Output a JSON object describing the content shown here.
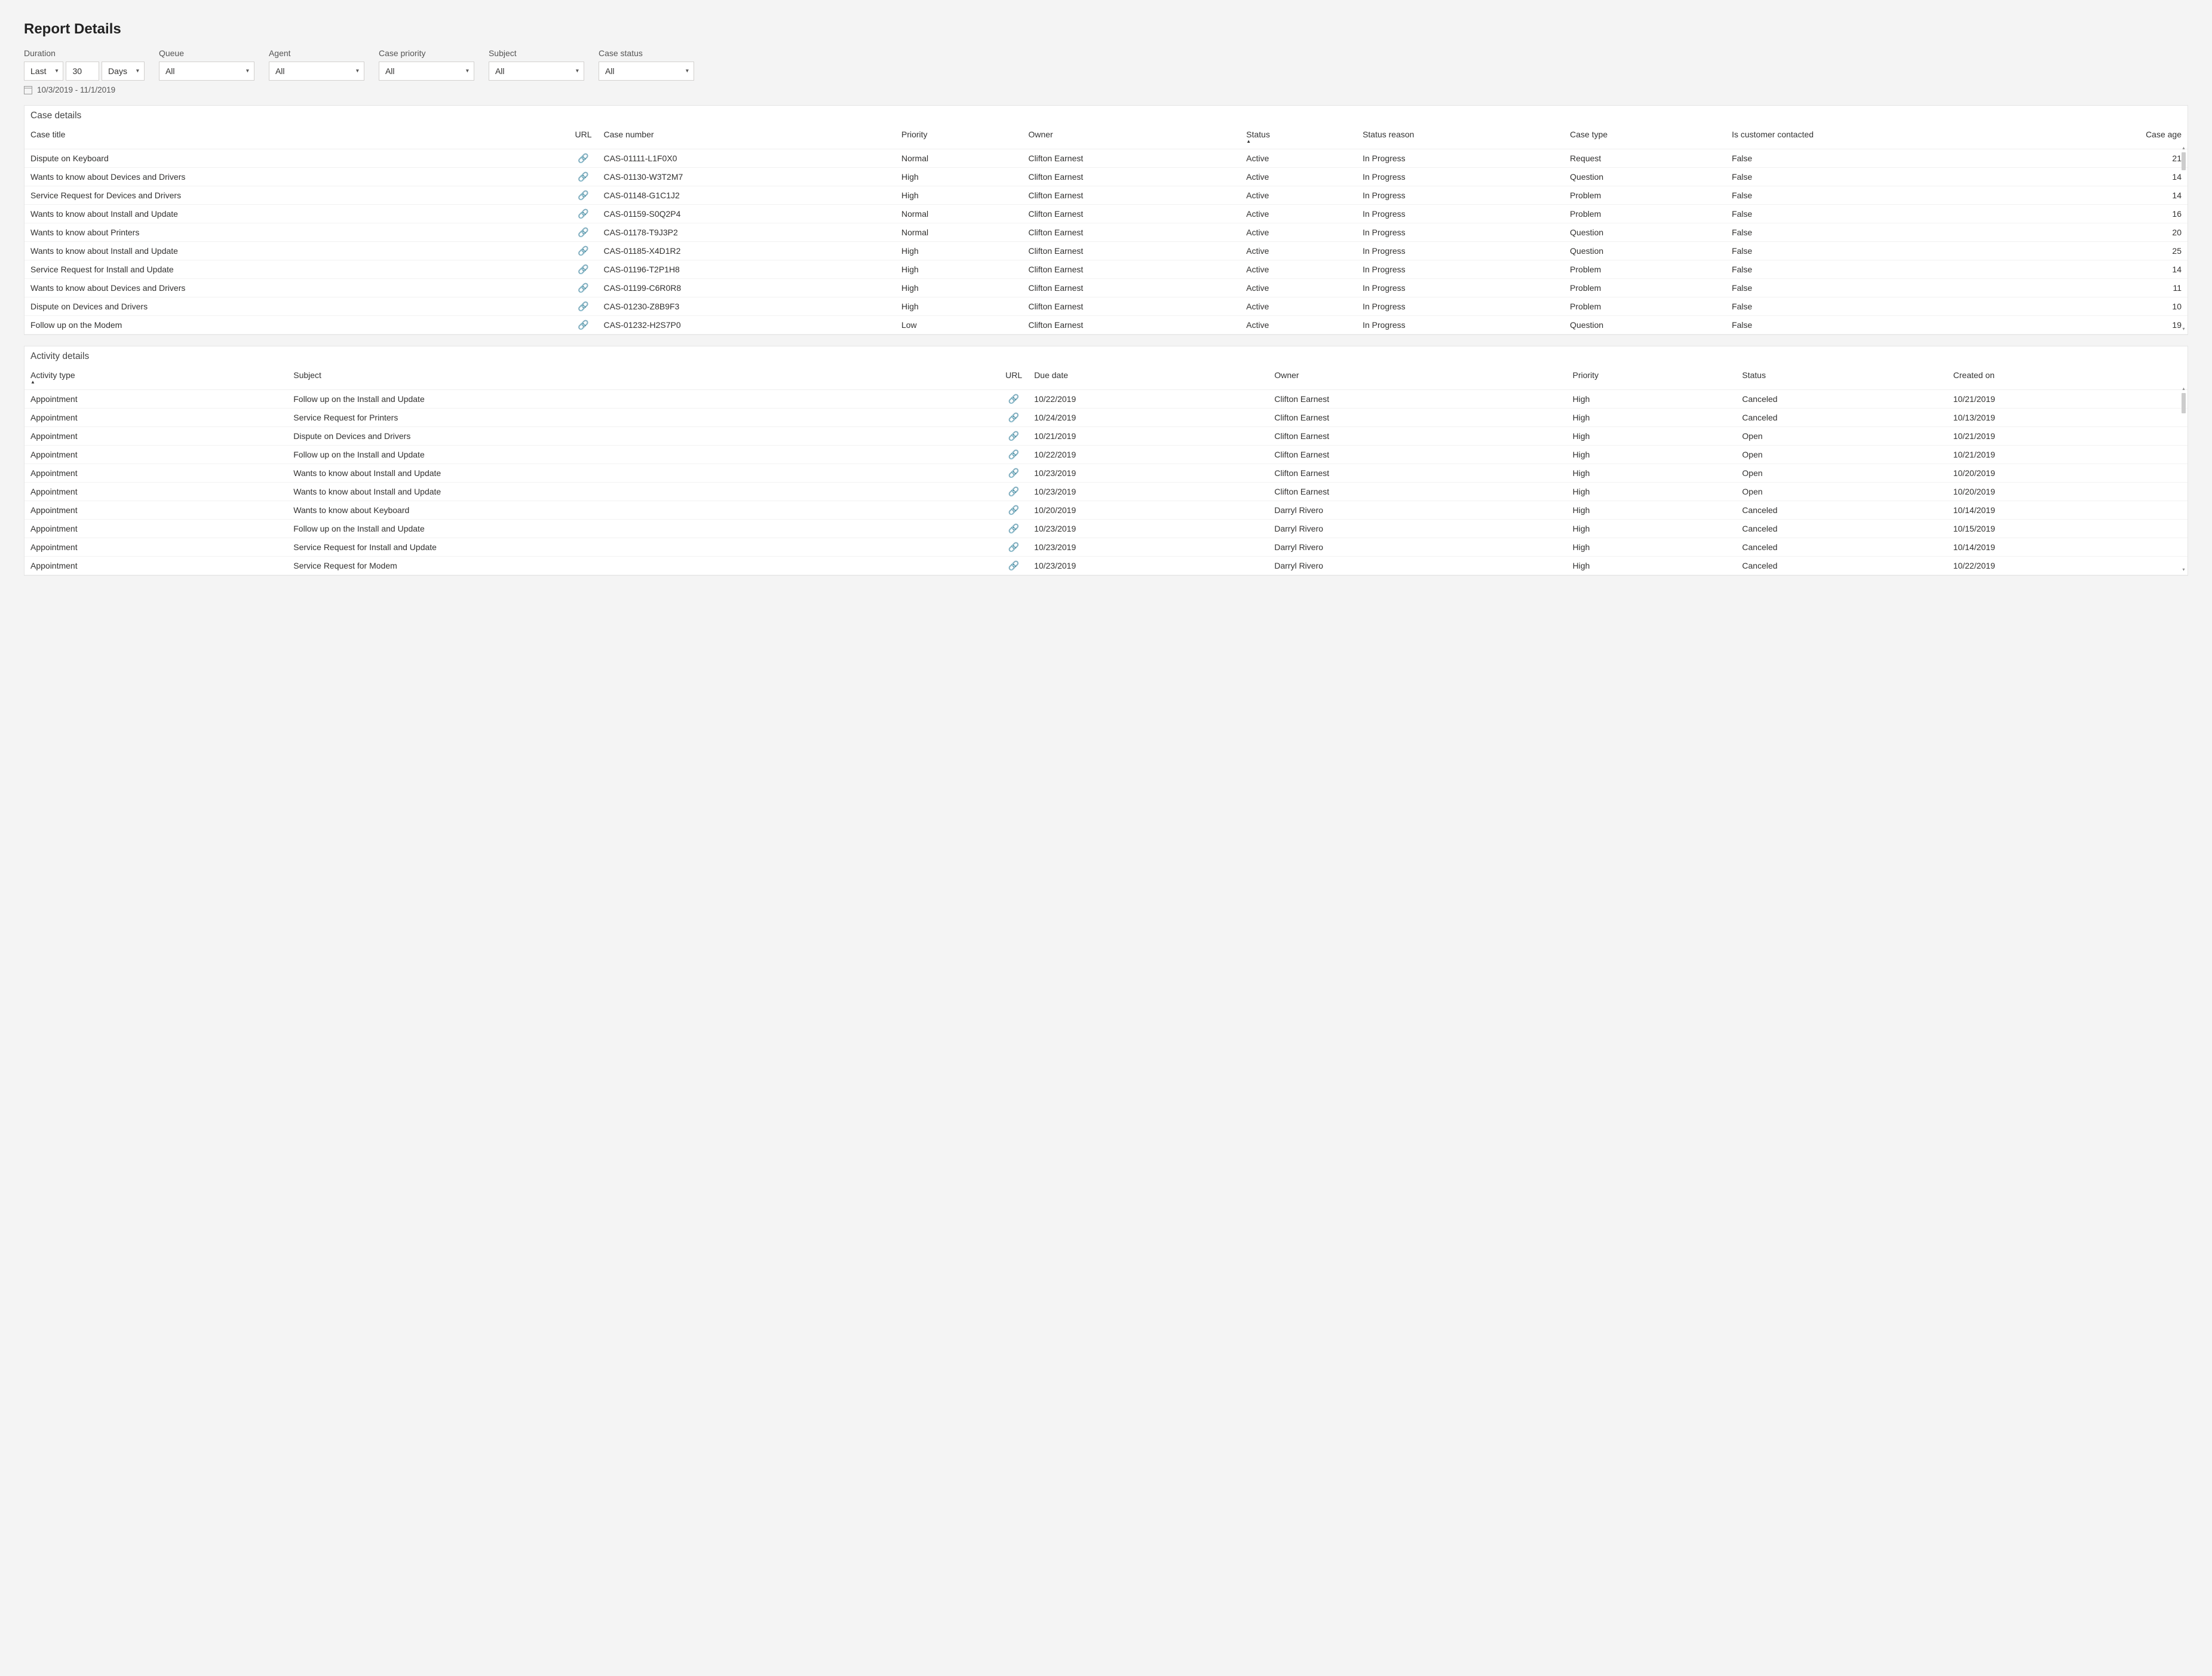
{
  "title": "Report Details",
  "filters": {
    "duration": {
      "label": "Duration",
      "relative": "Last",
      "value": "30",
      "unit": "Days"
    },
    "queue": {
      "label": "Queue",
      "value": "All"
    },
    "agent": {
      "label": "Agent",
      "value": "All"
    },
    "priority": {
      "label": "Case priority",
      "value": "All"
    },
    "subject": {
      "label": "Subject",
      "value": "All"
    },
    "status": {
      "label": "Case status",
      "value": "All"
    }
  },
  "dateRange": "10/3/2019 - 11/1/2019",
  "cases": {
    "title": "Case details",
    "headers": [
      "Case title",
      "URL",
      "Case number",
      "Priority",
      "Owner",
      "Status",
      "Status reason",
      "Case type",
      "Is customer contacted",
      "Case age"
    ],
    "sortedCol": "Status",
    "rows": [
      {
        "title": "Dispute on Keyboard",
        "num": "CAS-01111-L1F0X0",
        "priority": "Normal",
        "owner": "Clifton Earnest",
        "status": "Active",
        "reason": "In Progress",
        "type": "Request",
        "contacted": "False",
        "age": "21"
      },
      {
        "title": "Wants to know about Devices and Drivers",
        "num": "CAS-01130-W3T2M7",
        "priority": "High",
        "owner": "Clifton Earnest",
        "status": "Active",
        "reason": "In Progress",
        "type": "Question",
        "contacted": "False",
        "age": "14"
      },
      {
        "title": "Service Request for Devices and Drivers",
        "num": "CAS-01148-G1C1J2",
        "priority": "High",
        "owner": "Clifton Earnest",
        "status": "Active",
        "reason": "In Progress",
        "type": "Problem",
        "contacted": "False",
        "age": "14"
      },
      {
        "title": "Wants to know about Install and Update",
        "num": "CAS-01159-S0Q2P4",
        "priority": "Normal",
        "owner": "Clifton Earnest",
        "status": "Active",
        "reason": "In Progress",
        "type": "Problem",
        "contacted": "False",
        "age": "16"
      },
      {
        "title": "Wants to know about Printers",
        "num": "CAS-01178-T9J3P2",
        "priority": "Normal",
        "owner": "Clifton Earnest",
        "status": "Active",
        "reason": "In Progress",
        "type": "Question",
        "contacted": "False",
        "age": "20"
      },
      {
        "title": "Wants to know about Install and Update",
        "num": "CAS-01185-X4D1R2",
        "priority": "High",
        "owner": "Clifton Earnest",
        "status": "Active",
        "reason": "In Progress",
        "type": "Question",
        "contacted": "False",
        "age": "25"
      },
      {
        "title": "Service Request for Install and Update",
        "num": "CAS-01196-T2P1H8",
        "priority": "High",
        "owner": "Clifton Earnest",
        "status": "Active",
        "reason": "In Progress",
        "type": "Problem",
        "contacted": "False",
        "age": "14"
      },
      {
        "title": "Wants to know about Devices and Drivers",
        "num": "CAS-01199-C6R0R8",
        "priority": "High",
        "owner": "Clifton Earnest",
        "status": "Active",
        "reason": "In Progress",
        "type": "Problem",
        "contacted": "False",
        "age": "11"
      },
      {
        "title": "Dispute on Devices and Drivers",
        "num": "CAS-01230-Z8B9F3",
        "priority": "High",
        "owner": "Clifton Earnest",
        "status": "Active",
        "reason": "In Progress",
        "type": "Problem",
        "contacted": "False",
        "age": "10"
      },
      {
        "title": "Follow up on the  Modem",
        "num": "CAS-01232-H2S7P0",
        "priority": "Low",
        "owner": "Clifton Earnest",
        "status": "Active",
        "reason": "In Progress",
        "type": "Question",
        "contacted": "False",
        "age": "19"
      }
    ]
  },
  "activities": {
    "title": "Activity details",
    "headers": [
      "Activity type",
      "Subject",
      "URL",
      "Due date",
      "Owner",
      "Priority",
      "Status",
      "Created on"
    ],
    "sortedCol": "Activity type",
    "rows": [
      {
        "type": "Appointment",
        "subject": "Follow up on the Install and Update",
        "due": "10/22/2019",
        "owner": "Clifton Earnest",
        "priority": "High",
        "status": "Canceled",
        "created": "10/21/2019"
      },
      {
        "type": "Appointment",
        "subject": "Service Request for Printers",
        "due": "10/24/2019",
        "owner": "Clifton Earnest",
        "priority": "High",
        "status": "Canceled",
        "created": "10/13/2019"
      },
      {
        "type": "Appointment",
        "subject": "Dispute on Devices and Drivers",
        "due": "10/21/2019",
        "owner": "Clifton Earnest",
        "priority": "High",
        "status": "Open",
        "created": "10/21/2019"
      },
      {
        "type": "Appointment",
        "subject": "Follow up on the Install and Update",
        "due": "10/22/2019",
        "owner": "Clifton Earnest",
        "priority": "High",
        "status": "Open",
        "created": "10/21/2019"
      },
      {
        "type": "Appointment",
        "subject": "Wants to know about Install and Update",
        "due": "10/23/2019",
        "owner": "Clifton Earnest",
        "priority": "High",
        "status": "Open",
        "created": "10/20/2019"
      },
      {
        "type": "Appointment",
        "subject": "Wants to know about Install and Update",
        "due": "10/23/2019",
        "owner": "Clifton Earnest",
        "priority": "High",
        "status": "Open",
        "created": "10/20/2019"
      },
      {
        "type": "Appointment",
        "subject": "Wants to know about Keyboard",
        "due": "10/20/2019",
        "owner": "Darryl Rivero",
        "priority": "High",
        "status": "Canceled",
        "created": "10/14/2019"
      },
      {
        "type": "Appointment",
        "subject": "Follow up on the Install and Update",
        "due": "10/23/2019",
        "owner": "Darryl Rivero",
        "priority": "High",
        "status": "Canceled",
        "created": "10/15/2019"
      },
      {
        "type": "Appointment",
        "subject": "Service Request for Install and Update",
        "due": "10/23/2019",
        "owner": "Darryl Rivero",
        "priority": "High",
        "status": "Canceled",
        "created": "10/14/2019"
      },
      {
        "type": "Appointment",
        "subject": "Service Request for Modem",
        "due": "10/23/2019",
        "owner": "Darryl Rivero",
        "priority": "High",
        "status": "Canceled",
        "created": "10/22/2019"
      }
    ]
  }
}
